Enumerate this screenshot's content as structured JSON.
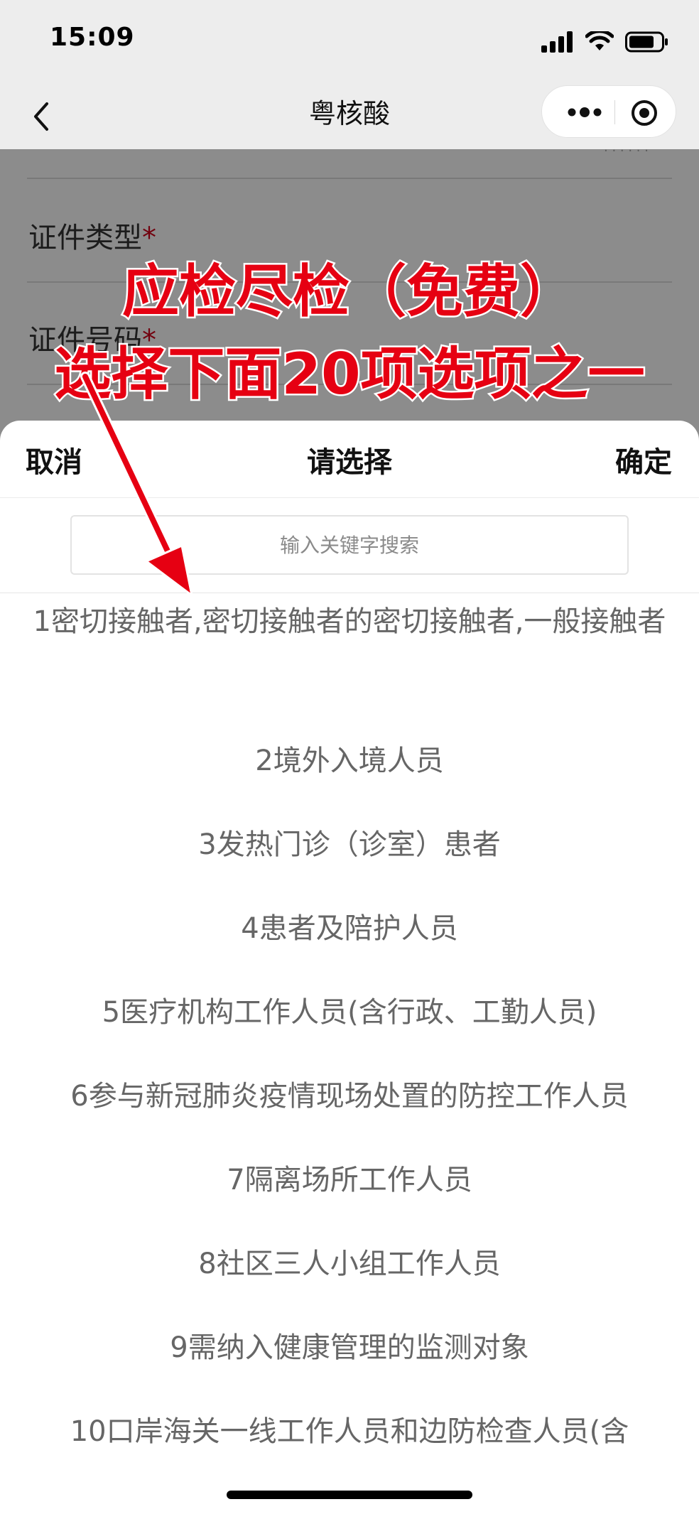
{
  "status_bar": {
    "time": "15:09"
  },
  "nav": {
    "title": "粤核酸"
  },
  "form": {
    "field_id_type": "证件类型",
    "field_id_number": "证件号码",
    "required_mark": "*"
  },
  "annotation": {
    "line1": "应检尽检（免费）",
    "line2": "选择下面20项选项之一",
    "color": "#e60012"
  },
  "picker": {
    "cancel_label": "取消",
    "title": "请选择",
    "confirm_label": "确定",
    "search_placeholder": "输入关键字搜索",
    "options": [
      "1密切接触者,密切接触者的密切接触者,一般接触者",
      "2境外入境人员",
      "3发热门诊（诊室）患者",
      "4患者及陪护人员",
      "5医疗机构工作人员(含行政、工勤人员)",
      "6参与新冠肺炎疫情现场处置的防控工作人员",
      "7隔离场所工作人员",
      "8社区三人小组工作人员",
      "9需纳入健康管理的监测对象",
      "10口岸海关一线工作人员和边防检查人员(含"
    ]
  }
}
